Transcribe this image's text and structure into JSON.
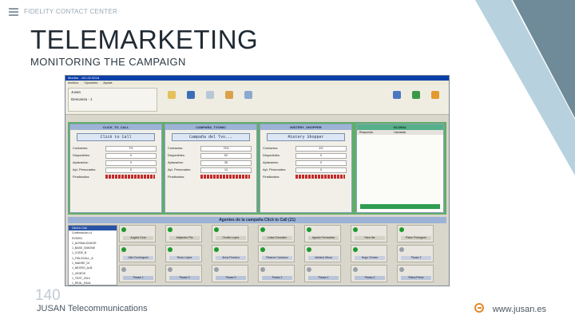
{
  "header": {
    "label": "FIDELITY CONTACT CENTER"
  },
  "title": "TELEMARKETING",
  "subtitle": "MONITORING THE CAMPAIGN",
  "footer": {
    "page_number": "140",
    "company": "JUSAN Telecommunications",
    "website": "www.jusan.es"
  },
  "colors": {
    "accent_stripe": "#b7d2de",
    "stripe_dark": "#6f8b99",
    "app_titlebar": "#0a3fa8",
    "campaign_bg": "#5fae6a"
  },
  "app": {
    "title": "Monitor - v01.02.0018",
    "menu": [
      "Archivo",
      "Opciones",
      "Ayuda"
    ],
    "user_box": {
      "user": "Jusan",
      "line2": "Descansa - 1"
    },
    "campaigns": [
      {
        "header": "CLICK_TO_CALL",
        "button": "Click to Call",
        "rows": [
          {
            "label": "Contactos:",
            "value": "7%"
          },
          {
            "label": "Disponibles:",
            "value": "0"
          },
          {
            "label": "Aplazados:",
            "value": "0"
          },
          {
            "label": "Apl. Personales:",
            "value": "0"
          },
          {
            "label": "Finalizados:",
            "value": ""
          }
        ]
      },
      {
        "header": "CAMPAÑA_TVOMIC",
        "button": "Campaña del Tvo...",
        "rows": [
          {
            "label": "Contactos:",
            "value": "73%"
          },
          {
            "label": "Disponibles:",
            "value": "52"
          },
          {
            "label": "Aplazados:",
            "value": "35"
          },
          {
            "label": "Apl. Personales:",
            "value": "14"
          },
          {
            "label": "Finalizados:",
            "value": ""
          }
        ]
      },
      {
        "header": "MISTERY_SHOPPER",
        "button": "Mistery Shopper",
        "rows": [
          {
            "label": "Contactos:",
            "value": "4%"
          },
          {
            "label": "Disponibles:",
            "value": "0"
          },
          {
            "label": "Aplazados:",
            "value": "0"
          },
          {
            "label": "Apl. Personales:",
            "value": "0"
          },
          {
            "label": "Finalizados:",
            "value": ""
          }
        ]
      }
    ],
    "global": {
      "header": "GLOBAL",
      "col1": "Respuesta",
      "col2": "Llamadas"
    },
    "agents_header": "Agentes de la campaña Click to Call (21)",
    "tree": [
      "Click to Call",
      "Confirmacion c1",
      "SVS0S1",
      "1_ALREALIZADOR",
      "1_BASE_SIMONE",
      "1_CODE_B",
      "1_FIALSCALL_A",
      "1_MADRE_DI",
      "1_NEGRO_ALB",
      "1_VIDEOS",
      "1_TEST_2014",
      "1_REAL_RAUL"
    ],
    "agents": [
      {
        "name": "Angela Guía",
        "state": "green"
      },
      {
        "name": "Alejandro Pla",
        "state": "green"
      },
      {
        "name": "Cecilia Lopez",
        "state": "green"
      },
      {
        "name": "Luisa Gonzalez",
        "state": "green"
      },
      {
        "name": "Agusto Fernandez",
        "state": "green"
      },
      {
        "name": "Sara Ibe",
        "state": "green"
      },
      {
        "name": "Pablo Portugues",
        "state": "green"
      },
      {
        "name": "Julio Domínguez",
        "state": "green"
      },
      {
        "name": "Rosa López",
        "state": "green"
      },
      {
        "name": "Anna Romero",
        "state": "green"
      },
      {
        "name": "Ricardo Carrasco",
        "state": "green"
      },
      {
        "name": "Adriana Musa",
        "state": "green"
      },
      {
        "name": "Hugo Gómez",
        "state": "green"
      },
      {
        "name": "Pausa 2",
        "state": "grey"
      },
      {
        "name": "Pausa 1",
        "state": "grey"
      },
      {
        "name": "Pausa 3",
        "state": "grey"
      },
      {
        "name": "Pausa 3",
        "state": "grey"
      },
      {
        "name": "Pausa 2",
        "state": "grey"
      },
      {
        "name": "Pausa 1",
        "state": "grey"
      },
      {
        "name": "Pausa 2",
        "state": "grey"
      },
      {
        "name": "Elena Pérez",
        "state": "grey"
      }
    ]
  }
}
